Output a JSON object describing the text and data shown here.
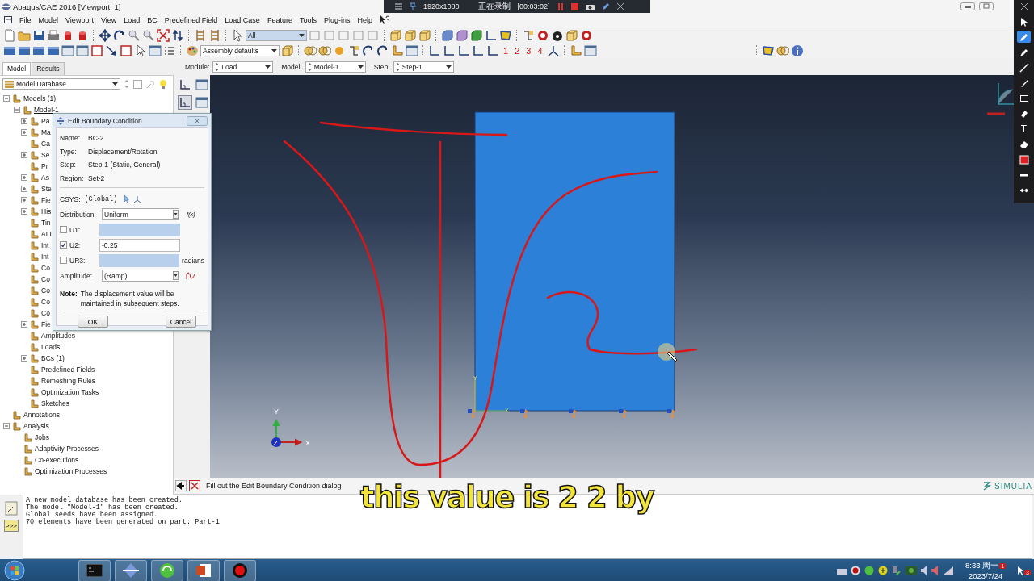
{
  "window": {
    "title": "Abaqus/CAE 2016 [Viewport: 1]"
  },
  "recorder": {
    "resolution": "1920x1080",
    "status": "正在录制",
    "timer": "[00:03:02]"
  },
  "menu": [
    "File",
    "Model",
    "Viewport",
    "View",
    "Load",
    "BC",
    "Predefined Field",
    "Load Case",
    "Feature",
    "Tools",
    "Plug-ins",
    "Help"
  ],
  "toolbar": {
    "selection_filter": "All",
    "render_style": "Assembly defaults",
    "view_numbers": [
      "1",
      "2",
      "3",
      "4"
    ]
  },
  "context": {
    "tabs": [
      {
        "label": "Model",
        "selected": true
      },
      {
        "label": "Results",
        "selected": false
      }
    ],
    "selectors": [
      {
        "label": "Module:",
        "value": "Load"
      },
      {
        "label": "Model:",
        "value": "Model-1"
      },
      {
        "label": "Step:",
        "value": "Step-1"
      }
    ]
  },
  "model_tree": {
    "source": "Model Database",
    "items": [
      {
        "label": "Models (1)",
        "expanded": true,
        "children": [
          {
            "label": "Model-1",
            "expanded": true,
            "current": true,
            "children": [
              {
                "label": "Pa",
                "expanded": false
              },
              {
                "label": "Ma",
                "expanded": false
              },
              {
                "label": "Ca"
              },
              {
                "label": "Se",
                "expanded": false
              },
              {
                "label": "Pr"
              },
              {
                "label": "As",
                "expanded": false
              },
              {
                "label": "Ste",
                "expanded": false
              },
              {
                "label": "Fie",
                "expanded": false
              },
              {
                "label": "His",
                "expanded": false
              },
              {
                "label": "Tin"
              },
              {
                "label": "ALI"
              },
              {
                "label": "Int"
              },
              {
                "label": "Int"
              },
              {
                "label": "Co"
              },
              {
                "label": "Co"
              },
              {
                "label": "Co"
              },
              {
                "label": "Co"
              },
              {
                "label": "Co"
              },
              {
                "label": "Fie",
                "expanded": false
              },
              {
                "label": "Amplitudes"
              },
              {
                "label": "Loads"
              },
              {
                "label": "BCs (1)",
                "expanded": false
              },
              {
                "label": "Predefined Fields"
              },
              {
                "label": "Remeshing Rules"
              },
              {
                "label": "Optimization Tasks"
              },
              {
                "label": "Sketches"
              }
            ]
          }
        ]
      },
      {
        "label": "Annotations"
      },
      {
        "label": "Analysis",
        "expanded": true,
        "children": [
          {
            "label": "Jobs"
          },
          {
            "label": "Adaptivity Processes"
          },
          {
            "label": "Co-executions"
          },
          {
            "label": "Optimization Processes"
          }
        ]
      }
    ]
  },
  "dialog": {
    "title": "Edit Boundary Condition",
    "info": [
      {
        "label": "Name:",
        "value": "BC-2"
      },
      {
        "label": "Type:",
        "value": "Displacement/Rotation"
      },
      {
        "label": "Step:",
        "value": "Step-1 (Static, General)"
      },
      {
        "label": "Region:",
        "value": "Set-2"
      }
    ],
    "csys": {
      "label": "CSYS:",
      "value": "(Global)"
    },
    "distribution": {
      "label": "Distribution:",
      "value": "Uniform",
      "function": "f(x)"
    },
    "dofs": [
      {
        "label": "U1:",
        "checked": false
      },
      {
        "label": "U2:",
        "checked": true,
        "value": "-0.25"
      },
      {
        "label": "UR3:",
        "checked": false,
        "unit": "radians"
      }
    ],
    "amplitude": {
      "label": "Amplitude:",
      "value": "(Ramp)"
    },
    "note": {
      "label": "Note:",
      "text": "The displacement value will be maintained in subsequent steps."
    },
    "buttons": [
      "OK",
      "Cancel"
    ]
  },
  "viewport": {
    "triad": {
      "y": "Y",
      "x": "X",
      "z": "Z"
    },
    "part_axes": {
      "y": "Y",
      "x": "X"
    }
  },
  "subtitle": "this value is 2 2 by",
  "prompt": "Fill out the Edit Boundary Condition dialog",
  "brand": "SIMULIA",
  "message_button": ">>>",
  "messages": [
    "A new model database has been created.",
    "The model \"Model-1\" has been created.",
    "Global seeds have been assigned.",
    "70 elements have been generated on part: Part-1"
  ],
  "annotation_tools": [
    {
      "kind": "pointer",
      "selected": false
    },
    {
      "kind": "pen",
      "selected": true
    },
    {
      "kind": "marker",
      "selected": false
    },
    {
      "kind": "line",
      "selected": false
    },
    {
      "kind": "brush",
      "selected": false
    },
    {
      "kind": "rectangle",
      "selected": false
    },
    {
      "kind": "eraser-tip",
      "selected": false
    },
    {
      "kind": "text",
      "label": "T",
      "selected": false
    },
    {
      "kind": "eraser",
      "selected": false
    },
    {
      "kind": "color",
      "selected": false
    },
    {
      "kind": "width",
      "selected": false
    },
    {
      "kind": "arrows",
      "selected": false
    }
  ],
  "taskbar": {
    "time": "8:33 周一",
    "date": "2023/7/24",
    "badges": [
      "1",
      "3"
    ]
  }
}
